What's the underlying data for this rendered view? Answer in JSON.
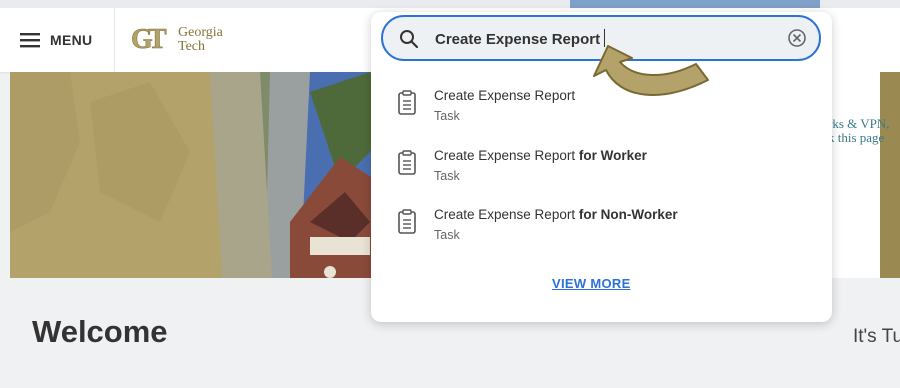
{
  "header": {
    "menu_label": "MENU",
    "logo_line1": "Georgia",
    "logo_line2": "Tech"
  },
  "search": {
    "value": "Create Expense Report",
    "results": [
      {
        "title_main": "Create Expense Report",
        "title_bold": "",
        "type": "Task"
      },
      {
        "title_main": "Create Expense Report ",
        "title_bold": "for Worker",
        "type": "Task"
      },
      {
        "title_main": "Create Expense Report ",
        "title_bold": "for Non-Worker",
        "type": "Task"
      }
    ],
    "view_more": "VIEW MORE"
  },
  "hero": {
    "side_text_line1": "rks & VPN,",
    "side_text_line2": "k this page"
  },
  "welcome": {
    "title": "Welcome",
    "side_text": "It's Tu"
  },
  "colors": {
    "accent_blue": "#2b73d6",
    "gt_gold": "#b3a36a"
  }
}
